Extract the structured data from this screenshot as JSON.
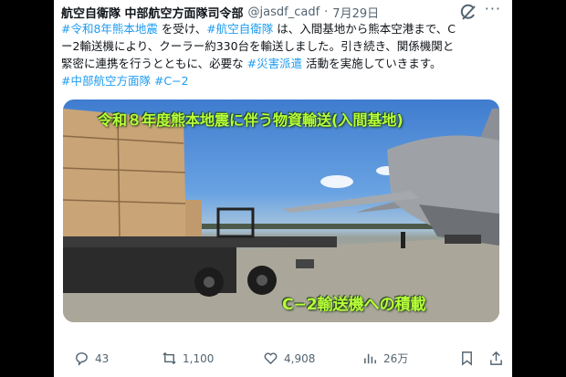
{
  "tweet": {
    "author": "航空自衛隊 中部航空方面隊司令部",
    "handle": "@jasdf_cadf",
    "separator": "·",
    "date": "7月29日",
    "more": "···",
    "line1_tag1": "#令和8年熊本地震",
    "line1_text1": " を受け、",
    "line1_tag2": "#航空自衛隊",
    "line1_text2": " は、入間基地から熊本空港まで、C",
    "line2_text": "ー2輸送機により、クーラー約330台を輸送しました。引き続き、関係機関と",
    "line3_text1": "緊密に連携を行うとともに、必要な",
    "line3_tag": " #災害派遣",
    "line3_text2": " 活動を実施していきます。",
    "line4_tag1": "#中部航空方面隊",
    "line4_tag2": " #C−2"
  },
  "media": {
    "title_overlay": "令和８年度熊本地震に伴う物資輸送(入間基地)",
    "subtitle_overlay": "C−2輸送機への積載"
  },
  "actions": {
    "replies": "43",
    "retweets": "1,100",
    "likes": "4,908",
    "views": "26万"
  },
  "icons": {
    "logo": "x-logo-icon",
    "more": "more-icon",
    "reply": "reply-icon",
    "retweet": "retweet-icon",
    "like": "heart-icon",
    "views": "views-icon",
    "bookmark": "bookmark-icon",
    "share": "share-icon"
  },
  "colors": {
    "hashtag": "#1d9bf0",
    "overlay_text": "#b6ff3a"
  }
}
